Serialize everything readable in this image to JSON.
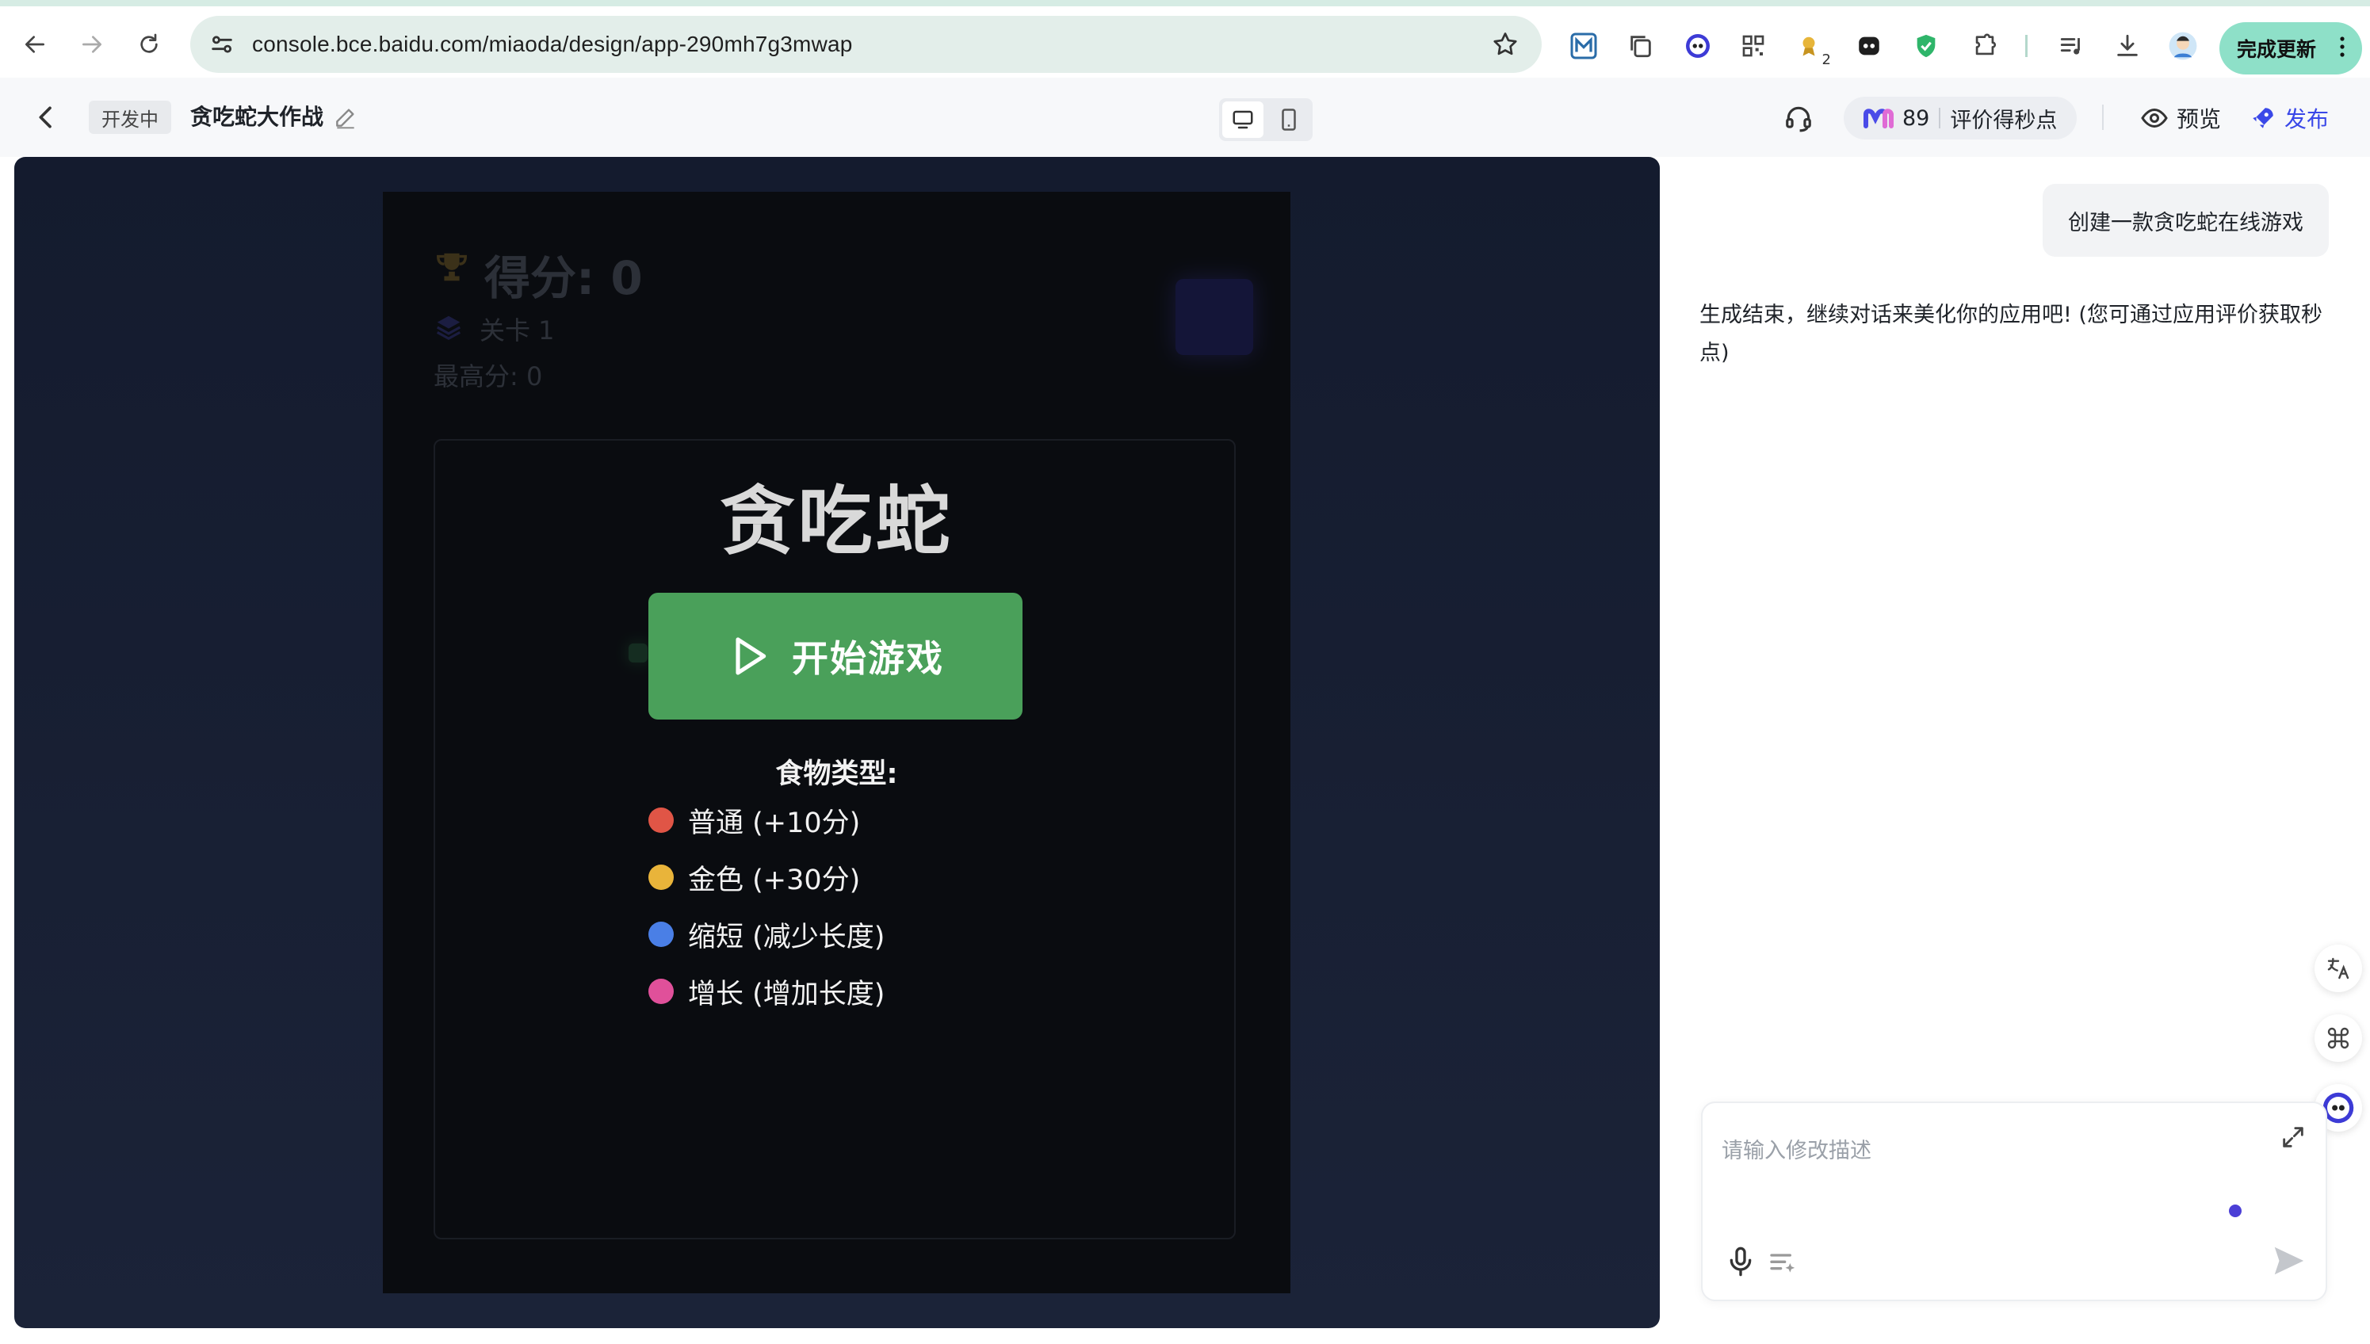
{
  "browser": {
    "url": "console.bce.baidu.com/miaoda/design/app-290mh7g3mwap",
    "extension_badge": "2",
    "update_button": "完成更新"
  },
  "header": {
    "status": "开发中",
    "app_name": "贪吃蛇大作战",
    "credits": "89",
    "credits_label": "评价得秒点",
    "preview": "预览",
    "publish": "发布"
  },
  "game": {
    "hud": {
      "score": "得分: 0",
      "level": "关卡 1",
      "best": "最高分: 0"
    },
    "title": "贪吃蛇",
    "start_button": "开始游戏",
    "food_title": "食物类型:",
    "foods": [
      {
        "label": "普通 (+10分)",
        "color": "#e05546"
      },
      {
        "label": "金色 (+30分)",
        "color": "#e9b43a"
      },
      {
        "label": "缩短 (减少长度)",
        "color": "#4a7fe6"
      },
      {
        "label": "增长 (增加长度)",
        "color": "#e0509a"
      }
    ]
  },
  "chat": {
    "user_message": "创建一款贪吃蛇在线游戏",
    "ai_message": "生成结束，继续对话来美化你的应用吧! (您可通过应用评价获取秒点)",
    "input_placeholder": "请输入修改描述"
  },
  "colors": {
    "accent": "#3a48e8",
    "start_button": "#4aa05a",
    "canvas_bg": "#141b2e"
  }
}
